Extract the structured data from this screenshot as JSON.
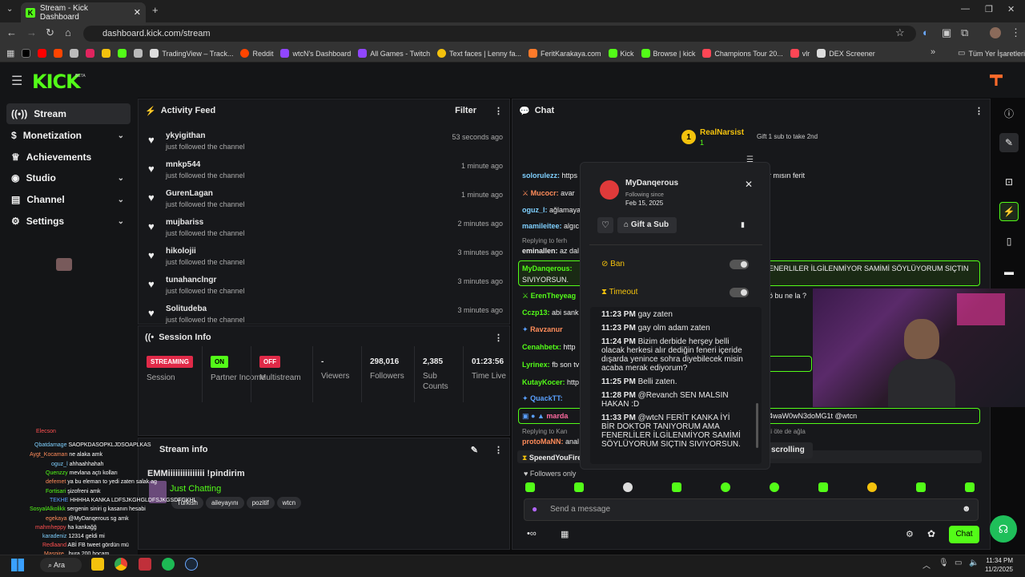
{
  "browser": {
    "tab_title": "Stream - Kick Dashboard",
    "url": "dashboard.kick.com/stream",
    "bookmarks": [
      "TradingView – Track...",
      "Reddit",
      "wtcN's Dashboard",
      "All Games - Twitch",
      "Text faces | Lenny fa...",
      "FeritKarakaya.com",
      "Kick",
      "Browse | kick",
      "Champions Tour 20...",
      "vlr",
      "DEX Screener"
    ],
    "all_bookmarks": "Tüm Yer İşaretleri"
  },
  "brand": {
    "logo": "KICK",
    "beta": "BETA",
    "accent": "#53fc18"
  },
  "sidebar": {
    "items": [
      {
        "label": "Stream",
        "icon": "broadcast-icon"
      },
      {
        "label": "Monetization",
        "icon": "dollar-icon"
      },
      {
        "label": "Achievements",
        "icon": "trophy-icon"
      },
      {
        "label": "Studio",
        "icon": "palette-icon"
      },
      {
        "label": "Channel",
        "icon": "channel-icon"
      },
      {
        "label": "Settings",
        "icon": "gear-icon"
      }
    ]
  },
  "activity": {
    "title": "Activity Feed",
    "filter": "Filter",
    "items": [
      {
        "name": "ykyigithan",
        "action": "just followed the channel",
        "time": "53 seconds ago"
      },
      {
        "name": "mnkp544",
        "action": "just followed the channel",
        "time": "1 minute ago"
      },
      {
        "name": "GurenLagan",
        "action": "just followed the channel",
        "time": "1 minute ago"
      },
      {
        "name": "mujbariss",
        "action": "just followed the channel",
        "time": "2 minutes ago"
      },
      {
        "name": "hikolojii",
        "action": "just followed the channel",
        "time": "3 minutes ago"
      },
      {
        "name": "tunahanclngr",
        "action": "just followed the channel",
        "time": "3 minutes ago"
      },
      {
        "name": "Solitudeba",
        "action": "just followed the channel",
        "time": "3 minutes ago"
      }
    ]
  },
  "session": {
    "title": "Session Info",
    "cells": [
      {
        "badge": "STREAMING",
        "label": "Session"
      },
      {
        "badge": "ON",
        "label": "Partner Income"
      },
      {
        "badge": "OFF",
        "label": "Multistream"
      },
      {
        "value": "-",
        "label": "Viewers"
      },
      {
        "value": "298,016",
        "label": "Followers"
      },
      {
        "value": "2,385",
        "label": "Sub Counts"
      },
      {
        "value": "01:23:56",
        "label": "Time Live"
      }
    ]
  },
  "stream_info": {
    "title": "Stream info",
    "stream_title": "EMMiiiiiiiiiiiiiii !pindirim",
    "category": "Just Chatting",
    "tags": [
      "Turkish",
      "aileyayını",
      "pozitif",
      "wtcn"
    ]
  },
  "chat": {
    "title": "Chat",
    "top_gifter": {
      "name": "RealNarsist",
      "rank": "1",
      "count": "1",
      "prompt": "Gift 1 sub to take 2nd"
    },
    "lines": [
      {
        "user": "solorulezz:",
        "text": "https",
        "color": "#7fd0ff",
        "tail": "r mısın ferit"
      },
      {
        "user": "Mucocr:",
        "text": "avar",
        "color": "#ff8c5a"
      },
      {
        "user": "oguz_l:",
        "text": "ağlamaya",
        "color": "#7fd0ff"
      },
      {
        "user": "mamileitee:",
        "text": "algıc",
        "color": "#7fd0ff"
      },
      {
        "user": "eminallen:",
        "text": "az dal",
        "color": "#eee"
      },
      {
        "user": "ErenTheyeag",
        "text": "",
        "color": "#53fc18"
      },
      {
        "user": "Cczp13:",
        "text": "abi sank",
        "color": "#53fc18"
      },
      {
        "user": "Ravzanur",
        "text": "",
        "color": "#ff8c5a"
      },
      {
        "user": "Cenahbetx:",
        "text": "http",
        "color": "#53fc18"
      },
      {
        "user": "Lyrinex:",
        "text": "fb son tv",
        "color": "#53fc18"
      },
      {
        "user": "KutayKocer:",
        "text": "http",
        "color": "#53fc18"
      },
      {
        "user": "QuackTT:",
        "text": "",
        "color": "#5aa0ff"
      },
      {
        "user": "marda",
        "text": "",
        "color": "#ff6aa0"
      },
      {
        "user": "protoMaNN:",
        "text": "anal",
        "color": "#ff8c5a"
      },
      {
        "user": "SpeendYouFire",
        "text": "",
        "color": "#eee"
      }
    ],
    "reply1": "Replying to ferh",
    "highlight1_user": "MyDanqerous:",
    "highlight1_text": "ENERLILER İLGİLENMİYOR SAMİMİ SÖYLÜYORUM SIÇTIN",
    "highlight1_text2": "SIVIYORSUN.",
    "reply2": "Replying to Kan",
    "highlight2_text": "4waW0wN3doMG1t @wtcn",
    "reply2_tail": "ti öte de ağla",
    "bune": "ö bu ne la ?",
    "scroll_label": "scrolling",
    "followers_only": "Followers only",
    "input_placeholder": "Send a message",
    "chat_button": "Chat"
  },
  "popup": {
    "username": "MyDanqerous",
    "following_since_label": "Following since",
    "following_since": "Feb 15, 2025",
    "gift": "Gift a Sub",
    "ban": "Ban",
    "timeout": "Timeout",
    "messages": [
      {
        "time": "11:23 PM",
        "text": "gay zaten"
      },
      {
        "time": "11:23 PM",
        "text": "gay olm adam zaten"
      },
      {
        "time": "11:24 PM",
        "text": "Bizim derbide herşey belli olacak herkesi alır dediğin feneri içeride dışarda yenince sohra diyebilecek misin acaba merak ediyorum?"
      },
      {
        "time": "11:25 PM",
        "text": "Belli zaten."
      },
      {
        "time": "11:28 PM",
        "text": "@Revanch SEN MALSIN HAKAN :D"
      },
      {
        "time": "11:33 PM",
        "text": "@wtcN FERİT KANKA İYİ BİR DOKTOR TANIYORUM AMA FENERLİLER İLGİLENMİYOR SAMİMİ SÖYLÜYORUM SIÇTIN SIVIYORSUN."
      }
    ]
  },
  "overlay_chat": [
    {
      "user": "Elecson",
      "text": "",
      "color": "#ff5050"
    },
    {
      "user": "Qbatdamage",
      "text": "SAOPKDASOPKLJDSOAPLKAS",
      "color": "#7fd0ff"
    },
    {
      "user": "Aygt_Kocaman",
      "text": "ne alaka amk",
      "color": "#ff8c5a"
    },
    {
      "user": "oguz_l",
      "text": "ahhaahhahah",
      "color": "#7fd0ff"
    },
    {
      "user": "Quenzzy",
      "text": "mevlana açtı kolları",
      "color": "#53fc18"
    },
    {
      "user": "defemet",
      "text": "ya bu eleman to yedi zaten salak ag",
      "color": "#ff8c5a"
    },
    {
      "user": "Fortisari",
      "text": "şizofreni amk",
      "color": "#53fc18"
    },
    {
      "user": "TEKHE",
      "text": "HHHHA KANKA LDFSJKGHGLDFSJKGSDFGKHL",
      "color": "#5aa0ff"
    },
    {
      "user": "SosyalAlkolikk",
      "text": "sergenin siniri g kasanın hesabi",
      "color": "#53fc18"
    },
    {
      "user": "egekaya",
      "text": "@MyDanqerous sg amk",
      "color": "#ff8c5a"
    },
    {
      "user": "mahmheppy",
      "text": "ha kankağğ",
      "color": "#ff5050"
    },
    {
      "user": "karadeniz",
      "text": "12314 geldi mi",
      "color": "#7fd0ff"
    },
    {
      "user": "Redlaand",
      "text": "ABİ FB tweet gördün mü",
      "color": "#ff5050"
    },
    {
      "user": "Maspire_",
      "text": "bura 200 hocam",
      "color": "#ff8c5a"
    }
  ],
  "taskbar": {
    "search": "Ara",
    "time": "11:34 PM",
    "date": "11/2/2025"
  }
}
